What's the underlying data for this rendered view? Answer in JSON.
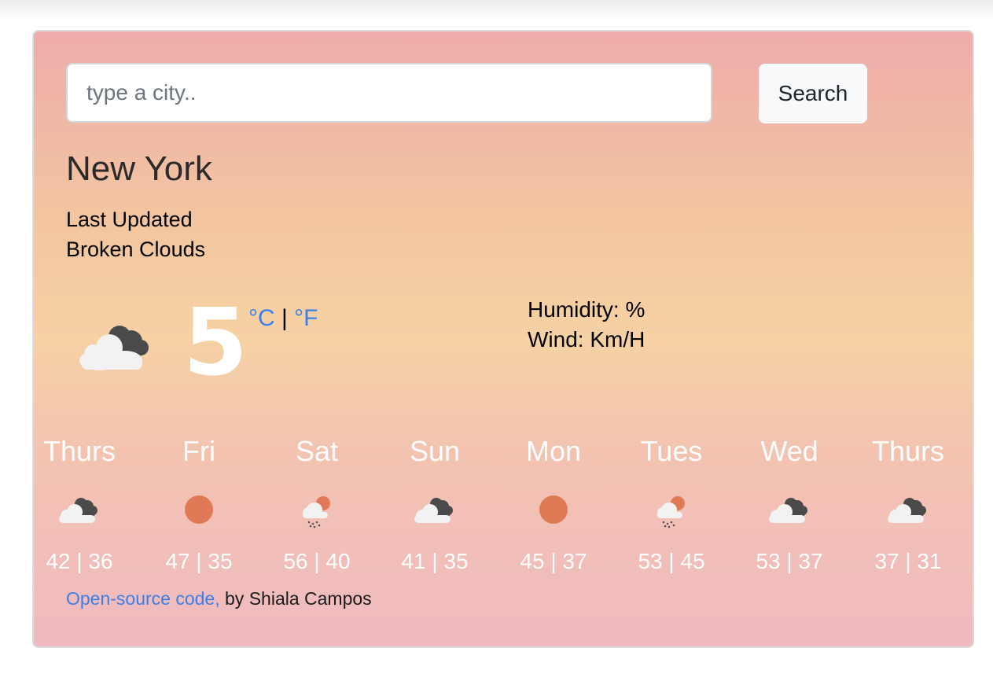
{
  "search": {
    "placeholder": "type a city..",
    "value": "",
    "button_label": "Search"
  },
  "current": {
    "city": "New York",
    "last_updated": "Last Updated",
    "description": "Broken Clouds",
    "icon": "broken-clouds-icon",
    "temperature": "5",
    "unit_celsius": "°C",
    "unit_separator": "|",
    "unit_fahrenheit": "°F",
    "humidity": "Humidity: %",
    "wind": "Wind: Km/H"
  },
  "forecast": [
    {
      "day": "Thurs",
      "icon": "broken-clouds-icon",
      "temps": "42 | 36"
    },
    {
      "day": "Fri",
      "icon": "sun-icon",
      "temps": "47 | 35"
    },
    {
      "day": "Sat",
      "icon": "rain-sun-icon",
      "temps": "56 | 40"
    },
    {
      "day": "Sun",
      "icon": "broken-clouds-icon",
      "temps": "41 | 35"
    },
    {
      "day": "Mon",
      "icon": "sun-icon",
      "temps": "45 | 37"
    },
    {
      "day": "Tues",
      "icon": "rain-sun-icon",
      "temps": "53 | 45"
    },
    {
      "day": "Wed",
      "icon": "broken-clouds-icon",
      "temps": "53 | 37"
    },
    {
      "day": "Thurs",
      "icon": "broken-clouds-icon",
      "temps": "37 | 31"
    }
  ],
  "footer": {
    "link_text": "Open-source code,",
    "author_text": " by Shiala Campos"
  },
  "colors": {
    "link": "#3a7fe8",
    "sun": "#e07a55",
    "cloud_light": "#f4f4f4",
    "cloud_dark": "#4a4a4a",
    "button_bg": "#f8f9fa"
  }
}
